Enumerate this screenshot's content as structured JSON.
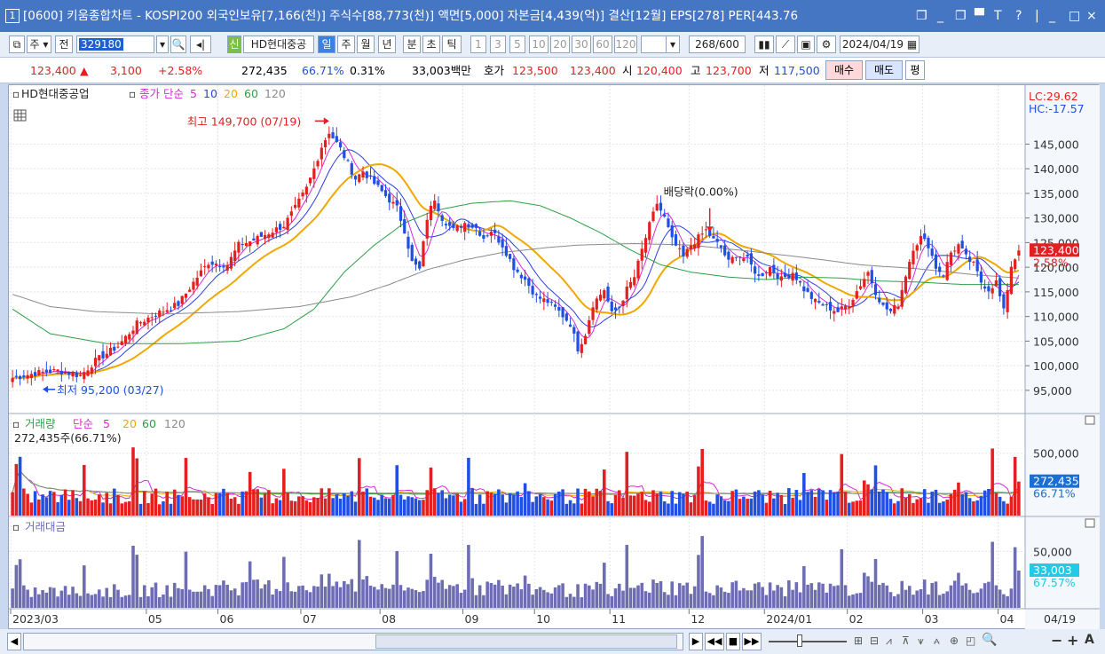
{
  "window": {
    "badge": "1",
    "title": "[0600] 키움종합차트 - KOSPI200 외국인보유[7,166(천)] 주식수[88,773(천)] 액면[5,000] 자본금[4,439(억)] 결산[12월] EPS[278] PER[443.76",
    "controls": [
      "❐",
      "_",
      "❐",
      "▀",
      "T",
      "?",
      "|",
      "_",
      "□",
      "×"
    ]
  },
  "toolbar": {
    "type_select": "주",
    "full_btn": "전",
    "code_value": "329180",
    "stock_name": "HD현대중공",
    "new_badge": "신",
    "periods": [
      "일",
      "주",
      "월",
      "년",
      "분",
      "초",
      "틱"
    ],
    "active_period": "일",
    "intervals": [
      "1",
      "3",
      "5",
      "10",
      "20",
      "30",
      "60",
      "120"
    ],
    "count_value": "268",
    "count_max": "/600",
    "date_value": "2024/04/19"
  },
  "quote": {
    "price": "123,400",
    "change_sign": "▲",
    "change": "3,100",
    "change_pct": "+2.58%",
    "volume": "272,435",
    "vol_ratio": "66.71%",
    "turnover": "0.31%",
    "amount": "33,003백만",
    "ask_label": "호가",
    "ask": "123,500",
    "bid": "123,400",
    "open_label": "시",
    "open": "120,400",
    "high_label": "고",
    "high": "123,700",
    "low_label": "저",
    "low": "117,500",
    "buy_btn": "매수",
    "sell_btn": "매도",
    "eval_btn": "평"
  },
  "colors": {
    "up": "#e31f1f",
    "down": "#1f4fe3",
    "ma5": "#d62ad6",
    "ma10": "#2a3fe0",
    "ma20": "#f0a800",
    "ma60": "#2e9e45",
    "ma120": "#8a8a8a",
    "amount_bar": "#6e6cb3",
    "price_badge": "#e31f1f",
    "vol_badge": "#1b6fd1",
    "amt_badge": "#22c9e8"
  },
  "chart_data": [
    {
      "type": "candlestick",
      "name": "HD현대중공업",
      "legend": [
        "종가",
        "단순",
        "5",
        "10",
        "20",
        "60",
        "120"
      ],
      "ylim": [
        93000,
        153000
      ],
      "yticks": [
        "145,000",
        "140,000",
        "135,000",
        "130,000",
        "125,000",
        "120,000",
        "115,000",
        "110,000",
        "105,000",
        "100,000",
        "95,000"
      ],
      "ytick_values": [
        145000,
        140000,
        135000,
        130000,
        125000,
        120000,
        115000,
        110000,
        105000,
        100000,
        95000
      ],
      "xticks": [
        "2023/03",
        "05",
        "06",
        "07",
        "08",
        "09",
        "10",
        "11",
        "12",
        "2024/01",
        "02",
        "03",
        "04"
      ],
      "right_info": [
        "LC:29.62",
        "HC:-17.57"
      ],
      "current_price_label": "123,400",
      "current_change_label": "2.58%",
      "current_price": 123400,
      "annotations": [
        {
          "text": "최고 149,700 (07/19)",
          "value": 149700,
          "date": "07/19"
        },
        {
          "text": "최저 95,200 (03/27)",
          "value": 95200,
          "date": "03/27"
        },
        {
          "text": "배당락(0.00%)"
        }
      ],
      "close_path": [
        [
          0,
          97500
        ],
        [
          6,
          98500
        ],
        [
          12,
          99000
        ],
        [
          18,
          98000
        ],
        [
          22,
          101000
        ],
        [
          28,
          104000
        ],
        [
          33,
          108500
        ],
        [
          38,
          110500
        ],
        [
          44,
          112500
        ],
        [
          49,
          118000
        ],
        [
          52,
          121000
        ],
        [
          57,
          120500
        ],
        [
          60,
          124500
        ],
        [
          64,
          125500
        ],
        [
          68,
          127000
        ],
        [
          72,
          128500
        ],
        [
          75,
          132000
        ],
        [
          78,
          136000
        ],
        [
          80,
          140000
        ],
        [
          82,
          144500
        ],
        [
          84,
          147500
        ],
        [
          87,
          144000
        ],
        [
          89,
          141000
        ],
        [
          91,
          138000
        ],
        [
          93,
          139500
        ],
        [
          96,
          137000
        ],
        [
          99,
          134500
        ],
        [
          102,
          132000
        ],
        [
          104,
          127500
        ],
        [
          106,
          121000
        ],
        [
          108,
          119500
        ],
        [
          110,
          130000
        ],
        [
          112,
          134000
        ],
        [
          114,
          130000
        ],
        [
          117,
          127500
        ],
        [
          120,
          129000
        ],
        [
          123,
          128000
        ],
        [
          125,
          126000
        ],
        [
          127,
          127500
        ],
        [
          130,
          124500
        ],
        [
          133,
          120000
        ],
        [
          136,
          117500
        ],
        [
          139,
          114000
        ],
        [
          142,
          113000
        ],
        [
          145,
          111000
        ],
        [
          148,
          108500
        ],
        [
          150,
          103500
        ],
        [
          152,
          106500
        ],
        [
          154,
          112500
        ],
        [
          157,
          115500
        ],
        [
          159,
          110500
        ],
        [
          161,
          112000
        ],
        [
          163,
          115500
        ],
        [
          165,
          118000
        ],
        [
          167,
          123500
        ],
        [
          169,
          128500
        ],
        [
          171,
          133000
        ],
        [
          173,
          130000
        ],
        [
          175,
          125500
        ],
        [
          178,
          122000
        ],
        [
          180,
          124500
        ],
        [
          182,
          126000
        ],
        [
          184,
          127500
        ],
        [
          186,
          125500
        ],
        [
          188,
          124000
        ],
        [
          190,
          121000
        ],
        [
          192,
          122500
        ],
        [
          195,
          121500
        ],
        [
          198,
          118000
        ],
        [
          201,
          120000
        ],
        [
          204,
          117500
        ],
        [
          207,
          119000
        ],
        [
          210,
          115500
        ],
        [
          213,
          113000
        ],
        [
          216,
          112000
        ],
        [
          219,
          111000
        ],
        [
          222,
          112500
        ],
        [
          225,
          116500
        ],
        [
          227,
          119000
        ],
        [
          229,
          115000
        ],
        [
          231,
          112000
        ],
        [
          233,
          111000
        ],
        [
          235,
          112500
        ],
        [
          237,
          118500
        ],
        [
          239,
          124000
        ],
        [
          241,
          126000
        ],
        [
          243,
          124500
        ],
        [
          245,
          120000
        ],
        [
          247,
          118500
        ],
        [
          249,
          123000
        ],
        [
          251,
          124500
        ],
        [
          253,
          122000
        ],
        [
          255,
          120500
        ],
        [
          257,
          117000
        ],
        [
          259,
          115500
        ],
        [
          261,
          117000
        ],
        [
          263,
          111000
        ],
        [
          265,
          120300
        ],
        [
          267,
          123400
        ]
      ],
      "series": [
        {
          "name": "5",
          "color_key": "ma5"
        },
        {
          "name": "10",
          "color_key": "ma10"
        },
        {
          "name": "20",
          "color_key": "ma20"
        },
        {
          "name": "60",
          "color_key": "ma60",
          "path": [
            [
              0,
              111500
            ],
            [
              10,
              106500
            ],
            [
              25,
              104500
            ],
            [
              45,
              104500
            ],
            [
              60,
              105000
            ],
            [
              72,
              107500
            ],
            [
              80,
              111500
            ],
            [
              88,
              119000
            ],
            [
              96,
              124500
            ],
            [
              104,
              129000
            ],
            [
              112,
              131500
            ],
            [
              122,
              133000
            ],
            [
              132,
              133500
            ],
            [
              140,
              132500
            ],
            [
              148,
              130000
            ],
            [
              156,
              127000
            ],
            [
              164,
              123500
            ],
            [
              172,
              120500
            ],
            [
              180,
              119000
            ],
            [
              190,
              118000
            ],
            [
              200,
              117500
            ],
            [
              210,
              118000
            ],
            [
              220,
              117800
            ],
            [
              230,
              117200
            ],
            [
              240,
              117000
            ],
            [
              252,
              116500
            ],
            [
              267,
              116500
            ]
          ]
        },
        {
          "name": "120",
          "color_key": "ma120",
          "path": [
            [
              0,
              114500
            ],
            [
              10,
              112000
            ],
            [
              22,
              111000
            ],
            [
              40,
              110500
            ],
            [
              60,
              111000
            ],
            [
              76,
              112000
            ],
            [
              90,
              114000
            ],
            [
              100,
              116500
            ],
            [
              110,
              119500
            ],
            [
              120,
              121500
            ],
            [
              130,
              123000
            ],
            [
              142,
              124000
            ],
            [
              150,
              124500
            ],
            [
              165,
              124800
            ],
            [
              180,
              124500
            ],
            [
              195,
              123300
            ],
            [
              210,
              122000
            ],
            [
              225,
              120500
            ],
            [
              240,
              119700
            ],
            [
              255,
              118500
            ],
            [
              267,
              117800
            ]
          ]
        }
      ]
    },
    {
      "type": "bar",
      "name": "거래량",
      "legend": [
        "거래량",
        "단순",
        "5",
        "20",
        "60",
        "120"
      ],
      "summary_label": "272,435주(66.71%)",
      "yticks": [
        "500,000"
      ],
      "ytick_values": [
        500000
      ],
      "ylim": [
        0,
        640000
      ],
      "current_label": "272,435",
      "current_pct": "66.71%",
      "current": 272435
    },
    {
      "type": "bar",
      "name": "거래대금",
      "legend": [
        "거래대금"
      ],
      "yticks": [
        "50,000"
      ],
      "ytick_values": [
        50000
      ],
      "ylim": [
        0,
        66000
      ],
      "current_label": "33,003",
      "current_pct": "67.57%",
      "current": 33003
    }
  ],
  "bottom": {
    "last_label": "04/19",
    "scroll_left": "◀",
    "nav": [
      "▶",
      "◀◀",
      "■",
      "▶▶"
    ],
    "tools": [
      "⊞",
      "⊟",
      "⩘",
      "⊼",
      "⩛",
      "⩜",
      "⊕",
      "◰",
      "🔍",
      "−",
      "+",
      "A"
    ]
  }
}
